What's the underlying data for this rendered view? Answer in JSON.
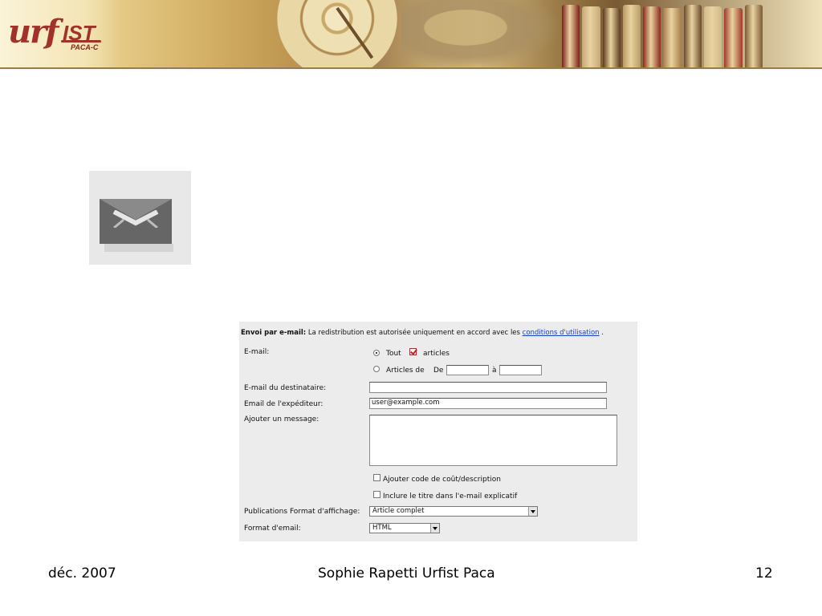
{
  "banner": {
    "logo_main": "urf",
    "logo_ist": "IST",
    "logo_sub": "PACA-C",
    "book_colors": [
      "#7a1f1a",
      "#c7a878",
      "#5a3a1e",
      "#b89a66",
      "#8b2a20",
      "#a77b4a",
      "#6b4a2a",
      "#d2b98a",
      "#9c3a2a",
      "#7d5a33"
    ]
  },
  "envelope": {
    "icon": "envelope-icon"
  },
  "form": {
    "header_bold": "Envoi par e-mail:",
    "header_text": " La redistribution est autorisée uniquement en accord avec les ",
    "header_link": "conditions d'utilisation",
    "header_end": "  .",
    "email_label": "E-mail:",
    "option_all": "Tout",
    "option_articles": "articles",
    "option_articles_de": "Articles de",
    "from_label": "De",
    "to_label": "à",
    "recipient_label": "E-mail du destinataire:",
    "recipient_value": "",
    "sender_label": "Email de l'expéditeur:",
    "sender_value": "user@example.com",
    "message_label": "Ajouter un message:",
    "message_value": "",
    "check_cost": "Ajouter code de coût/description",
    "check_title": "Inclure le titre dans l'e-mail explicatif",
    "display_format_label": "Publications Format d'affichage:",
    "display_format_value": "Article complet",
    "email_format_label": "Format d'email:",
    "email_format_value": "HTML"
  },
  "footer": {
    "date": "déc. 2007",
    "author": "Sophie Rapetti Urfist Paca",
    "page": "12"
  }
}
